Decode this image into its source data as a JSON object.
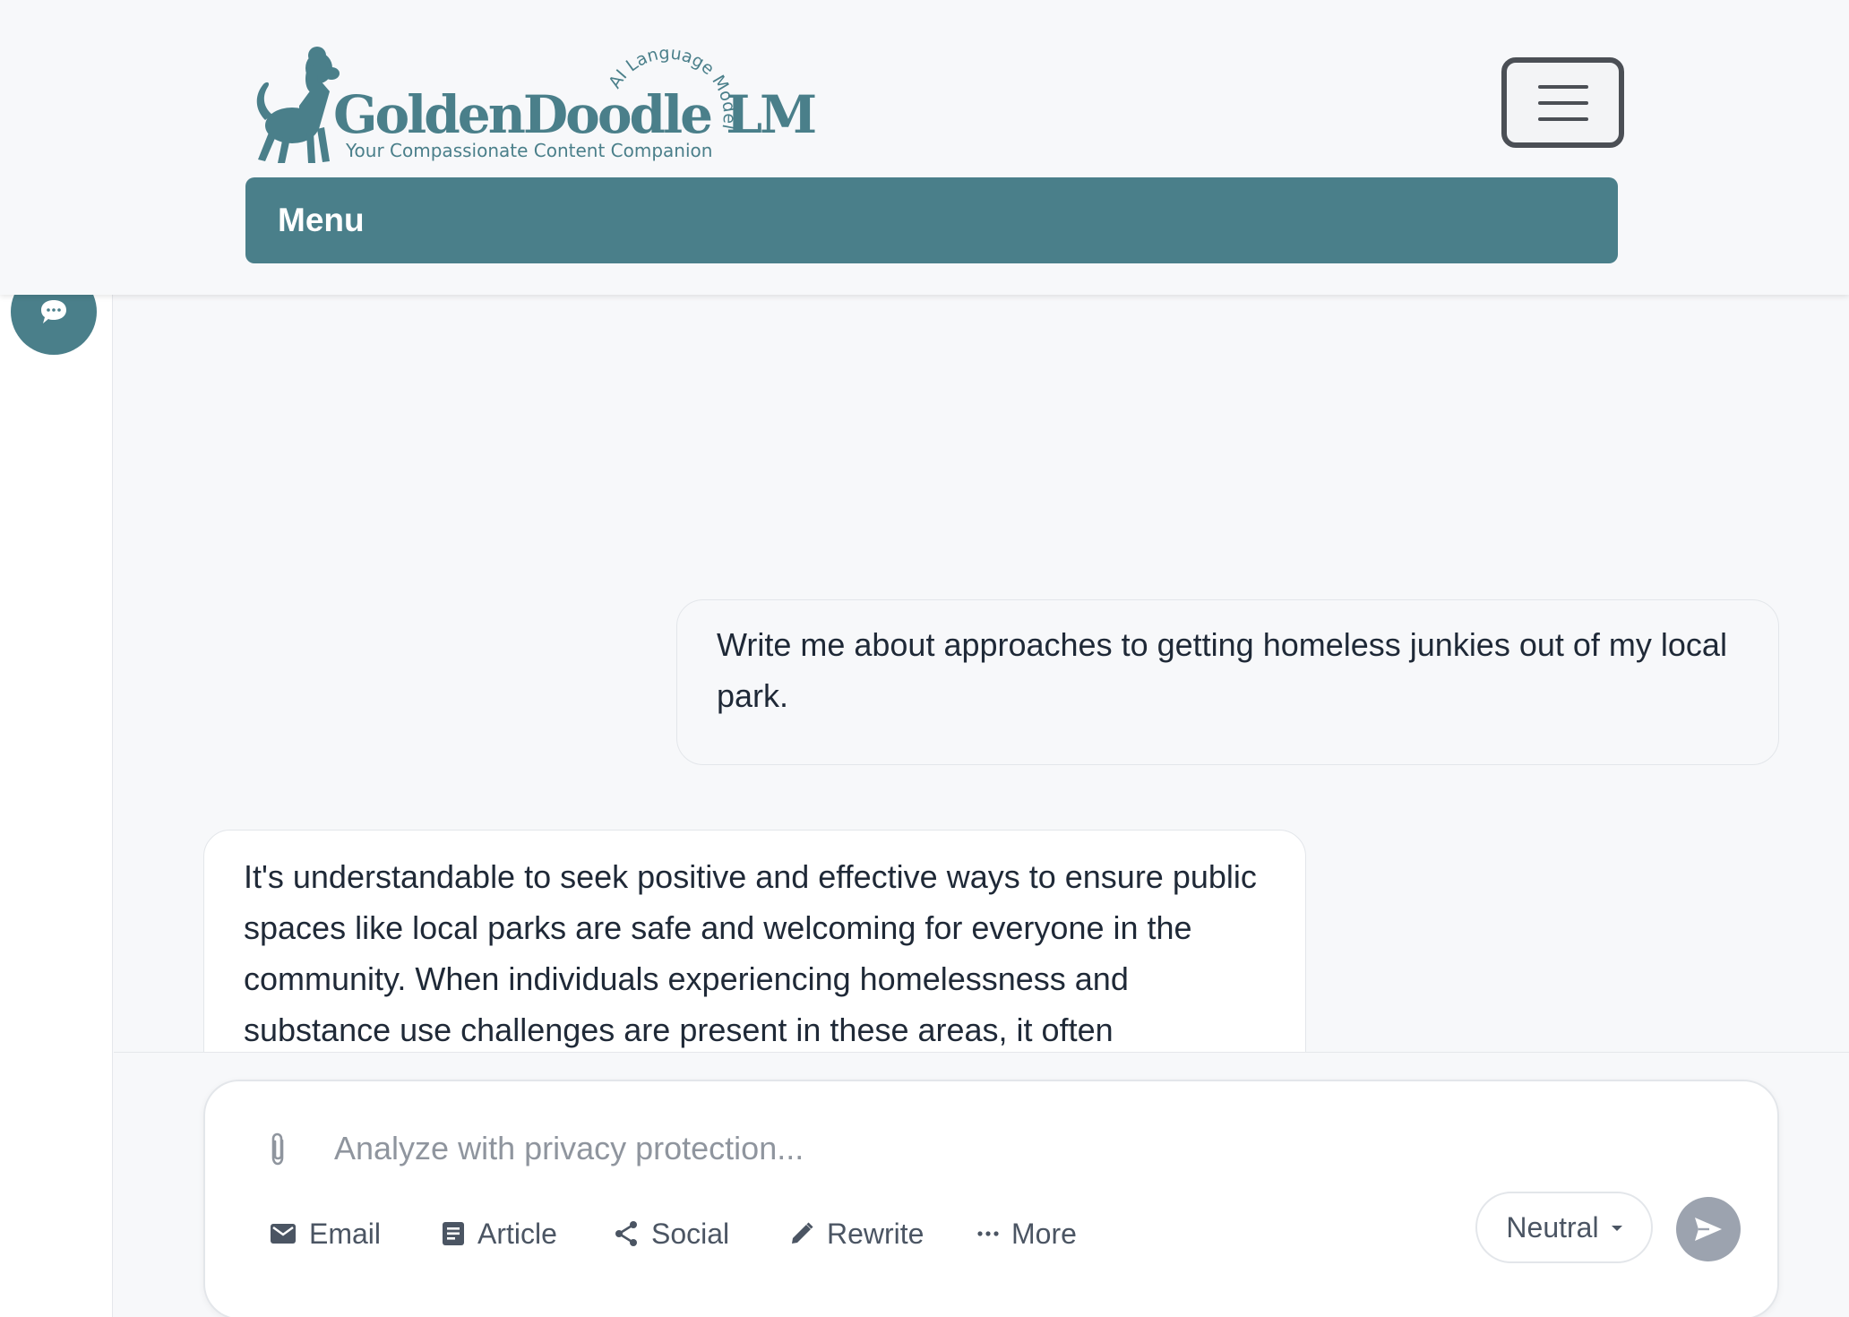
{
  "brand": {
    "name": "GoldenDoodle LM",
    "arc_text": "AI Language Model",
    "tagline": "Your Compassionate Content Companion",
    "color": "#4a7f8a"
  },
  "header": {
    "menu_label": "Menu",
    "toggle_icon": "hamburger-icon"
  },
  "rail": {
    "chat_icon": "chat-bubble-icon"
  },
  "conversation": {
    "user_message": "Write me about approaches to getting homeless junkies out of my local park.",
    "assistant_message": "It's understandable to seek positive and effective ways to ensure public spaces like local parks are safe and welcoming for everyone in the community. When individuals experiencing homelessness and substance use challenges are present in these areas, it often"
  },
  "composer": {
    "placeholder": "Analyze with privacy protection...",
    "value": "",
    "attach_icon": "paperclip-icon",
    "actions": [
      {
        "label": "Email",
        "icon": "mail-icon"
      },
      {
        "label": "Article",
        "icon": "document-icon"
      },
      {
        "label": "Social",
        "icon": "share-icon"
      },
      {
        "label": "Rewrite",
        "icon": "pencil-icon"
      },
      {
        "label": "More",
        "icon": "ellipsis-icon"
      }
    ],
    "tone_selected": "Neutral",
    "send_icon": "send-icon",
    "send_color": "#9ca3af"
  }
}
